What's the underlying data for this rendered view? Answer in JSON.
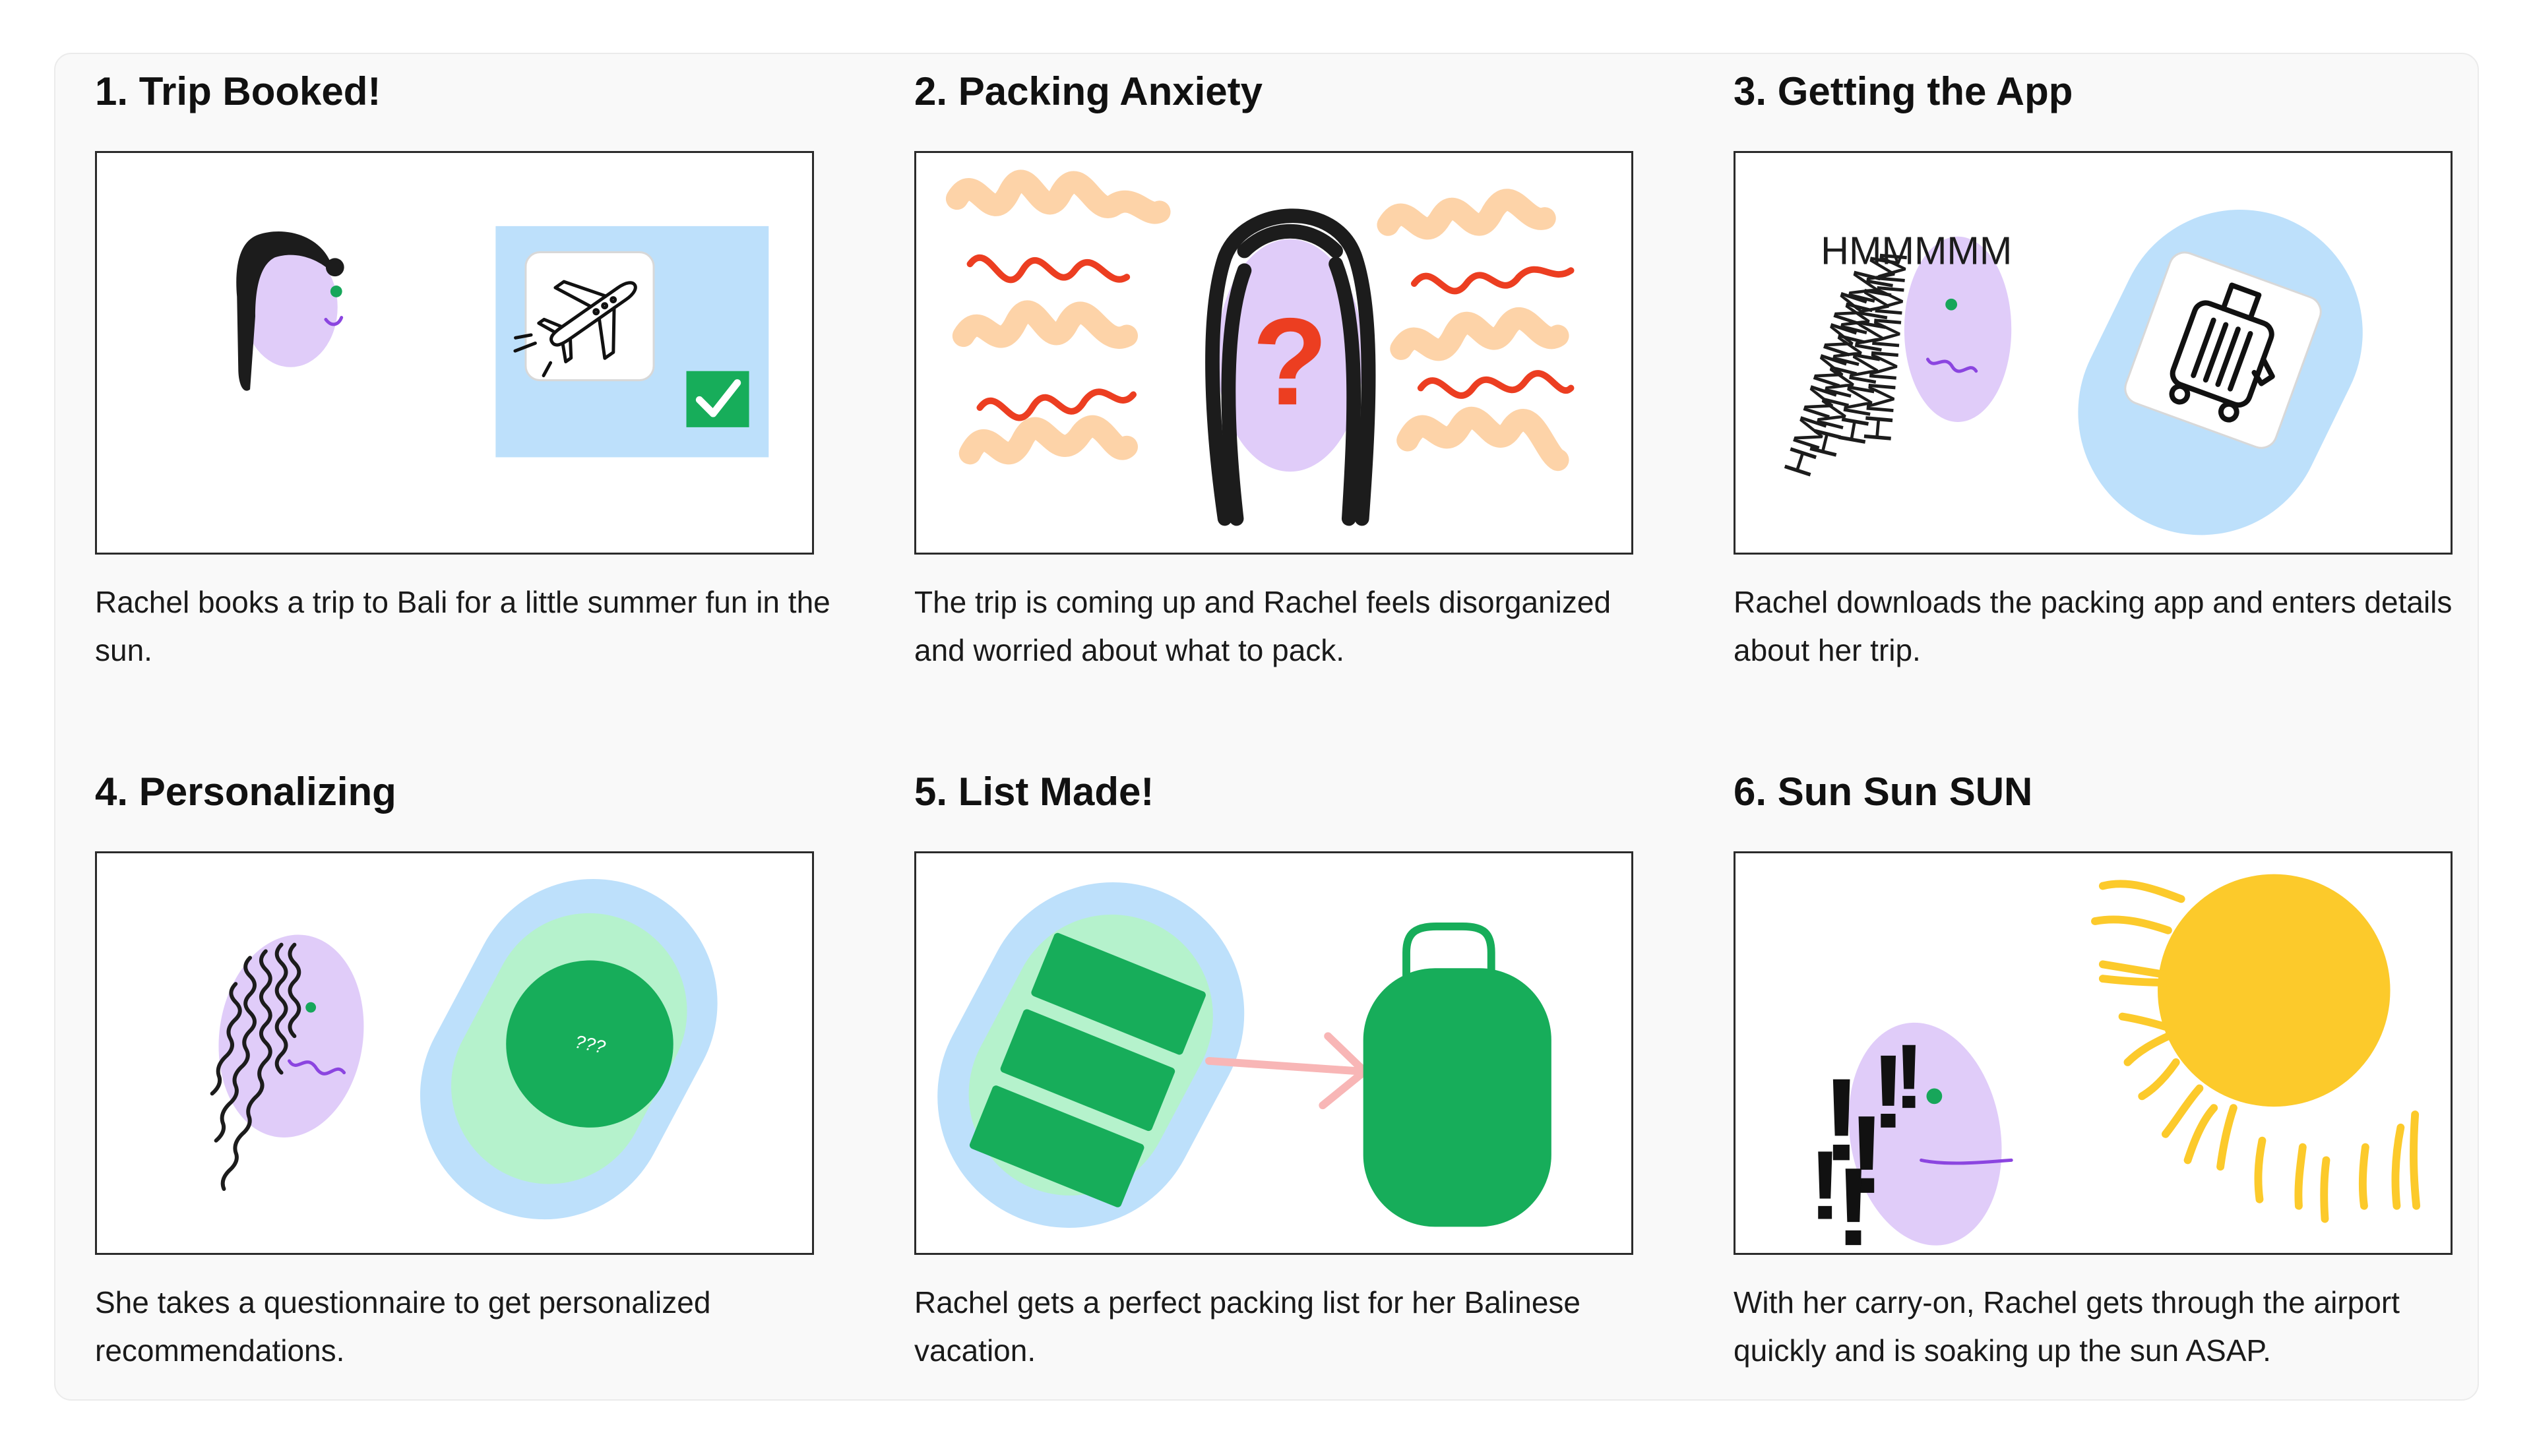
{
  "panels": [
    {
      "title": "1. Trip Booked!",
      "text": "Rachel books a trip to Bali for a little summer fun in the sun."
    },
    {
      "title": "2. Packing Anxiety",
      "text": "The trip is coming up and Rachel feels disorganized and worried about what to pack.",
      "symbol": "?"
    },
    {
      "title": "3. Getting the App",
      "text": "Rachel downloads the packing app and enters details about her trip.",
      "thought": "HMMMMM"
    },
    {
      "title": "4. Personalizing",
      "text": "She takes a questionnaire to get personalized recommendations.",
      "badge": "???"
    },
    {
      "title": "5. List Made!",
      "text": "Rachel gets a perfect packing list for her Balinese vacation."
    },
    {
      "title": "6. Sun Sun SUN",
      "text": "With her carry-on, Rachel gets through the airport quickly and is soaking up the sun ASAP.",
      "exclaim": "!"
    }
  ],
  "colors": {
    "face": "#e0ccf9",
    "hair": "#1c1c1c",
    "eye": "#17a65a",
    "mouth": "#8b45e0",
    "blue": "#bde0fb",
    "mint": "#b5f2cc",
    "green": "#17ad5a",
    "orange_scribble": "#fdd3a8",
    "red_scribble": "#ec3e21",
    "arrow": "#f8b6b6",
    "sun": "#fcca2b"
  },
  "icons": [
    "airplane-icon",
    "checkmark-icon",
    "luggage-icon"
  ]
}
